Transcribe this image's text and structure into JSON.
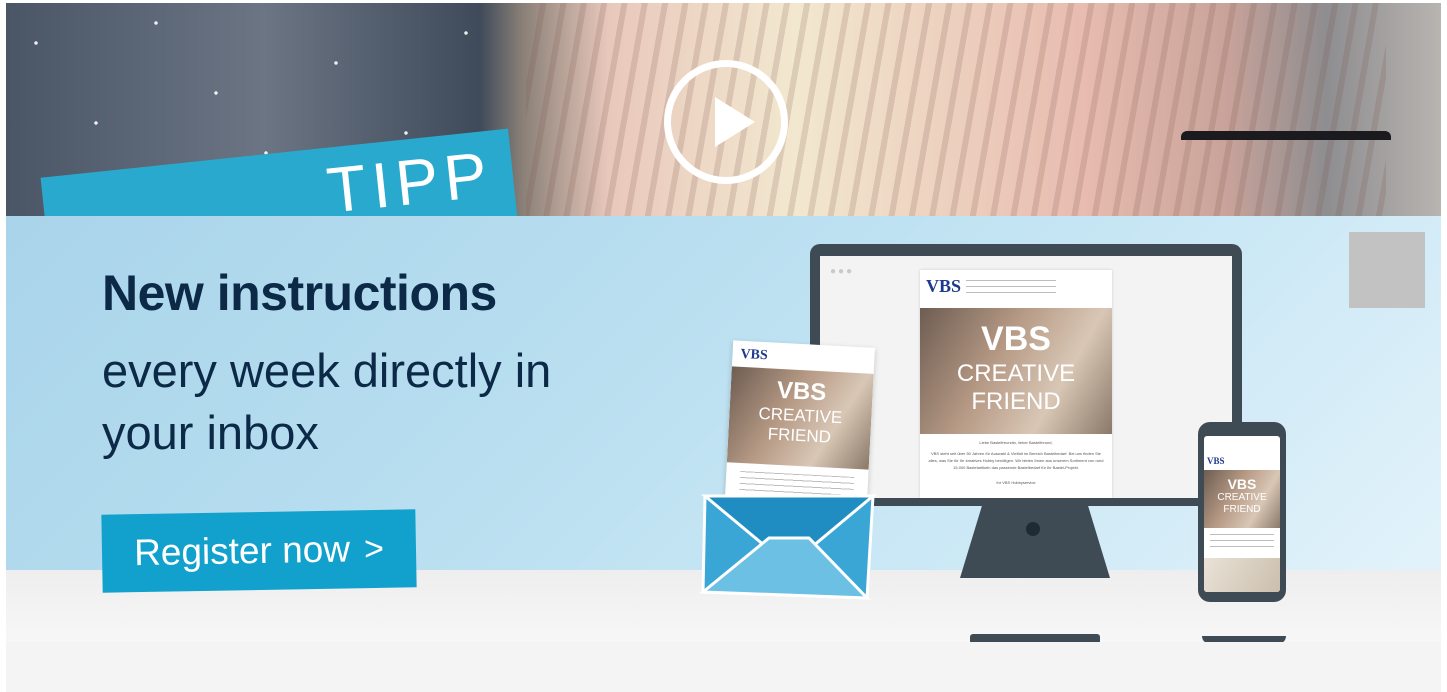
{
  "video": {
    "play_icon": "play-circle-icon",
    "sign_text": "TIPP"
  },
  "promo": {
    "headline": "New instructions",
    "subline": "every week directly in your inbox",
    "cta_label": "Register now",
    "cta_icon": "chevron-right-icon",
    "colors": {
      "headline": "#0c2a47",
      "cta_background": "#12a1cd",
      "device_frame": "#3e4b55"
    }
  },
  "newsletter_preview": {
    "logo": "VBS",
    "brand_line1": "VBS",
    "brand_line2": "CREATIVE",
    "brand_line3": "FRIEND",
    "greeting": "Liebe Bastelfreundin, lieber Bastelfreund,",
    "body": "VBS steht seit über 50 Jahren für Auswahl & Vielfalt im Bereich Bastelbedarf. Bei uns finden Sie alles, was Sie für Ihr kreatives Hobby benötigen. Wir bieten Ihnen aus unserem Sortiment von rund 15.000 Bastelartikeln das passende Bastelbedarf für Ihr Bastel-Projekt.",
    "signature": "Ihr VBS Hobbyservice"
  }
}
